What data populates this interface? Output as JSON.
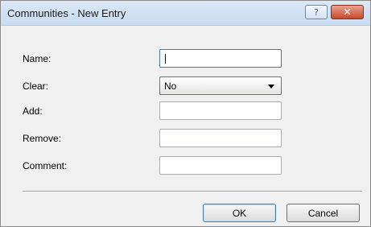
{
  "window": {
    "title": "Communities - New Entry",
    "help_label": "?",
    "close_label": "✕"
  },
  "form": {
    "fields": [
      {
        "label": "Name:",
        "value": ""
      },
      {
        "label": "Clear:",
        "value": "No"
      },
      {
        "label": "Add:",
        "value": ""
      },
      {
        "label": "Remove:",
        "value": ""
      },
      {
        "label": "Comment:",
        "value": ""
      }
    ]
  },
  "buttons": {
    "ok_label": "OK",
    "cancel_label": "Cancel"
  }
}
